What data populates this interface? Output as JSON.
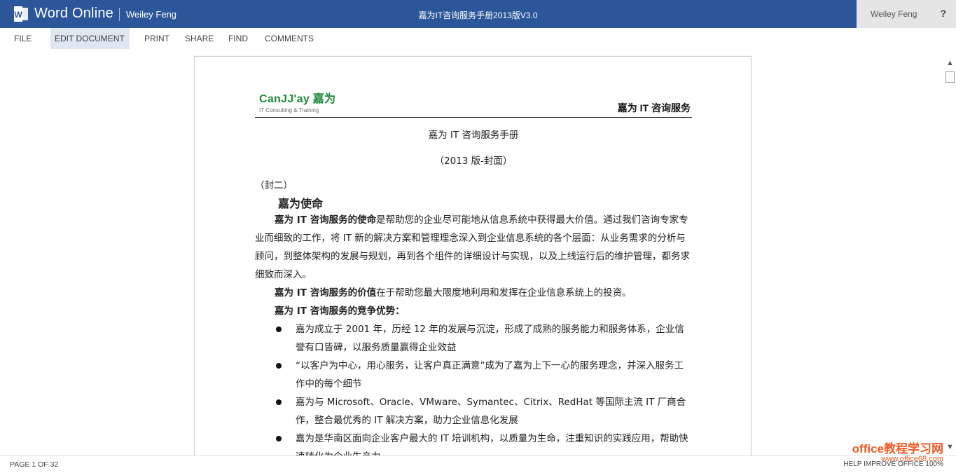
{
  "app": {
    "name": "Word Online",
    "owner": "Weiley Feng",
    "doc_title": "嘉为IT咨询服务手册2013版V3.0",
    "user": "Weiley Feng",
    "help": "?"
  },
  "menu": {
    "file": "FILE",
    "edit": "EDIT DOCUMENT",
    "print": "PRINT",
    "share": "SHARE",
    "find": "FIND",
    "comments": "COMMENTS"
  },
  "document": {
    "header_logo_text": "CanJJ'ay 嘉为",
    "header_logo_sub": "IT Consulting & Training",
    "header_title": "嘉为 IT 咨询服务",
    "title": "嘉为 IT 咨询服务手册",
    "subtitle": "（2013 版-封面）",
    "cover2": "（封二）",
    "mission_heading": "嘉为使命",
    "mission_bold": "嘉为 IT 咨询服务的使命",
    "mission_text": "是帮助您的企业尽可能地从信息系统中获得最大价值。通过我们咨询专家专业而细致的工作，将 IT 新的解决方案和管理理念深入到企业信息系统的各个层面：从业务需求的分析与顾问，到整体架构的发展与规划，再到各个组件的详细设计与实现，以及上线运行后的维护管理，都务求细致而深入。",
    "value_bold": "嘉为 IT 咨询服务的价值",
    "value_text": "在于帮助您最大限度地利用和发挥在企业信息系统上的投资。",
    "advantage_heading": "嘉为 IT 咨询服务的竞争优势：",
    "bullets": [
      "嘉为成立于 2001 年，历经 12 年的发展与沉淀，形成了成熟的服务能力和服务体系，企业信誉有口皆碑，以服务质量赢得企业效益",
      "“以客户为中心，用心服务，让客户真正满意”成为了嘉为上下一心的服务理念，并深入服务工作中的每个细节",
      "嘉为与 Microsoft、Oracle、VMware、Symantec、Citrix、RedHat 等国际主流 IT 厂商合作，整合最优秀的 IT 解决方案，助力企业信息化发展",
      "嘉为是华南区面向企业客户最大的 IT 培训机构，以质量为生命，注重知识的实践应用，帮助快速转化为企业生产力"
    ]
  },
  "status": {
    "page": "PAGE 1 OF 32",
    "right": "HELP IMPROVE OFFICE   100%"
  },
  "watermark": {
    "line1": "office教程学习网",
    "line2": "www.office68.com"
  },
  "colors": {
    "brand": "#2b579a",
    "logo_green": "#1c8a3a",
    "watermark": "#f05a24"
  }
}
